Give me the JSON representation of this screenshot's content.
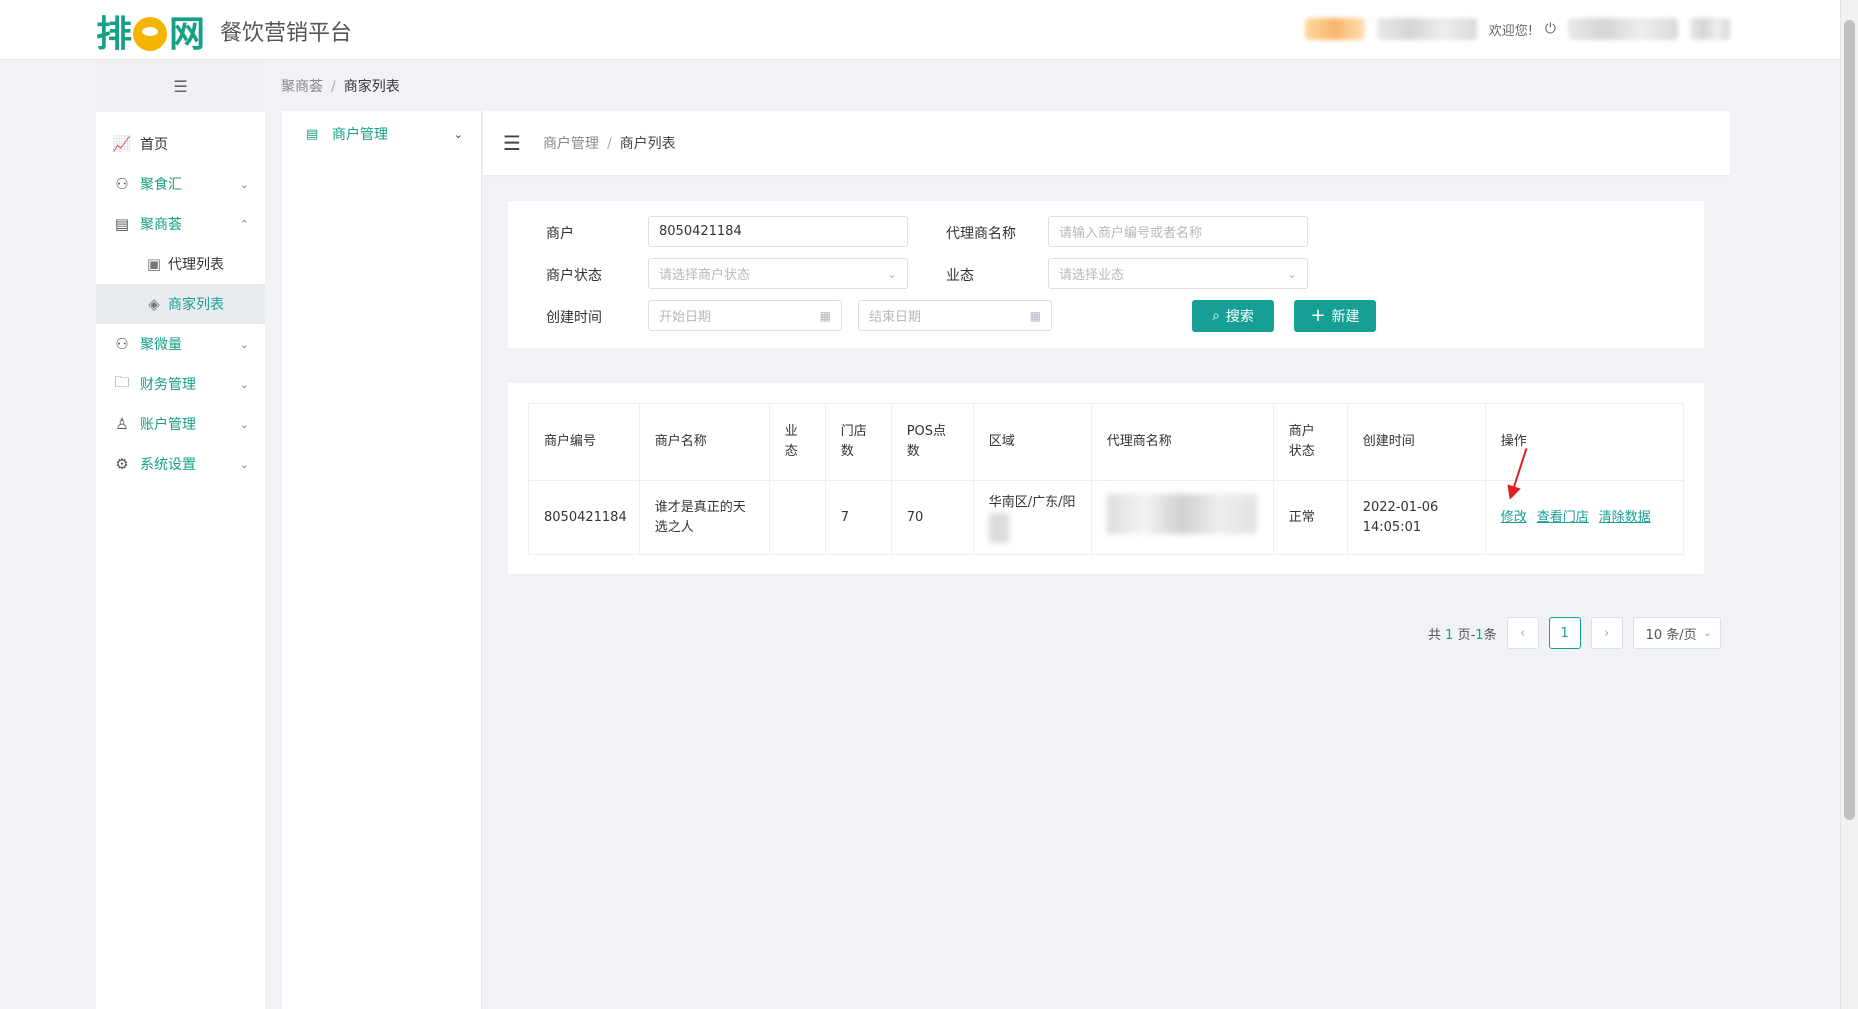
{
  "header": {
    "logo_text": "排队网",
    "platform_title": "餐饮营销平台",
    "welcome_text": "欢迎您!"
  },
  "sidebar": {
    "toggle_icon": "collapse-icon",
    "items": [
      {
        "label": "首页",
        "icon": "chart-icon"
      },
      {
        "label": "聚食汇",
        "icon": "user-group-icon"
      },
      {
        "label": "聚商荟",
        "icon": "store-icon"
      },
      {
        "label": "代理列表",
        "icon": "list-search-icon"
      },
      {
        "label": "商家列表",
        "icon": "layers-icon"
      },
      {
        "label": "聚微量",
        "icon": "user-group-icon"
      },
      {
        "label": "财务管理",
        "icon": "folder-icon"
      },
      {
        "label": "账户管理",
        "icon": "user-icon"
      },
      {
        "label": "系统设置",
        "icon": "gear-icon"
      }
    ]
  },
  "top_breadcrumb": {
    "parent": "聚商荟",
    "current": "商家列表"
  },
  "inner_sidebar": {
    "label": "商户管理"
  },
  "content_breadcrumb": {
    "parent": "商户管理",
    "current": "商户列表"
  },
  "filters": {
    "merchant_label": "商户",
    "merchant_value": "8050421184",
    "agent_label": "代理商名称",
    "agent_placeholder": "请输入商户编号或者名称",
    "status_label": "商户状态",
    "status_placeholder": "请选择商户状态",
    "business_label": "业态",
    "business_placeholder": "请选择业态",
    "created_label": "创建时间",
    "start_placeholder": "开始日期",
    "end_placeholder": "结束日期",
    "search_button": "搜索",
    "new_button": "新建"
  },
  "table": {
    "headers": [
      "商户编号",
      "商户名称",
      "业态",
      "门店数",
      "POS点数",
      "区域",
      "代理商名称",
      "商户状态",
      "创建时间",
      "操作"
    ],
    "rows": [
      {
        "merchant_id": "8050421184",
        "merchant_name": "谁才是真正的天选之人",
        "business": "",
        "store_count": "7",
        "pos_count": "70",
        "region": "华南区/广东/阳",
        "agent_name": "",
        "status": "正常",
        "created": "2022-01-06 14:05:01",
        "actions": [
          "修改",
          "查看门店",
          "清除数据"
        ]
      }
    ]
  },
  "pagination": {
    "prefix": "共",
    "pages": "1",
    "middle": "页-",
    "count": "1",
    "suffix": "条",
    "current_page": "1",
    "page_size": "10 条/页"
  },
  "colors": {
    "accent": "#16a095",
    "arrow": "#e02020"
  }
}
